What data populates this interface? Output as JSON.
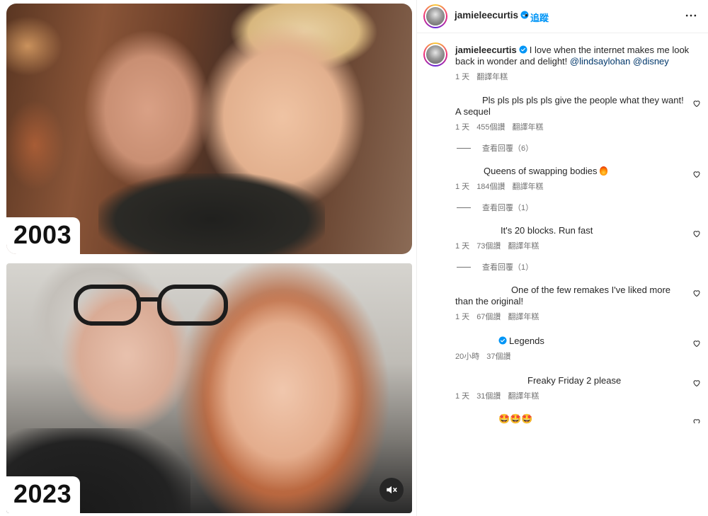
{
  "media": {
    "top_year": "2003",
    "bottom_year": "2023"
  },
  "header": {
    "username": "jamieleecurtis",
    "separator": "•",
    "follow_label": "追蹤"
  },
  "caption": {
    "username": "jamieleecurtis",
    "text": "I love when the internet makes me look back in wonder and delight!",
    "mention1": "@lindsaylohan",
    "mention2": "@disney",
    "time": "1 天",
    "translate": "翻譯年糕"
  },
  "comments": [
    {
      "text": "Pls pls pls pls pls give the people what they want! A sequel",
      "time": "1 天",
      "likes": "455個讚",
      "translate": "翻譯年糕",
      "replies": "查看回覆（6）"
    },
    {
      "text": "Queens of swapping bodies",
      "time": "1 天",
      "likes": "184個讚",
      "translate": "翻譯年糕",
      "replies": "查看回覆（1）"
    },
    {
      "text": "It's 20 blocks. Run fast",
      "time": "1 天",
      "likes": "73個讚",
      "translate": "翻譯年糕",
      "replies": "查看回覆（1）"
    },
    {
      "text": "One of the few remakes I've liked more than the original!",
      "time": "1 天",
      "likes": "67個讚",
      "translate": "翻譯年糕"
    },
    {
      "text": "Legends",
      "time": "20小時",
      "likes": "37個讚"
    },
    {
      "text": "Freaky Friday 2 please",
      "time": "1 天",
      "likes": "31個讚",
      "translate": "翻譯年糕"
    },
    {
      "text": "🤩🤩🤩"
    }
  ],
  "colors": {
    "link_blue": "#0095f6",
    "mention_blue": "#00376b",
    "secondary_text": "#737373",
    "verified_blue": "#0095f6"
  },
  "icons": {
    "verified": "verified-badge-icon",
    "more": "more-horizontal-icon",
    "heart": "heart-outline-icon",
    "mute": "speaker-muted-icon",
    "fire": "fire-emoji",
    "star_struck": "star-struck-emoji"
  }
}
